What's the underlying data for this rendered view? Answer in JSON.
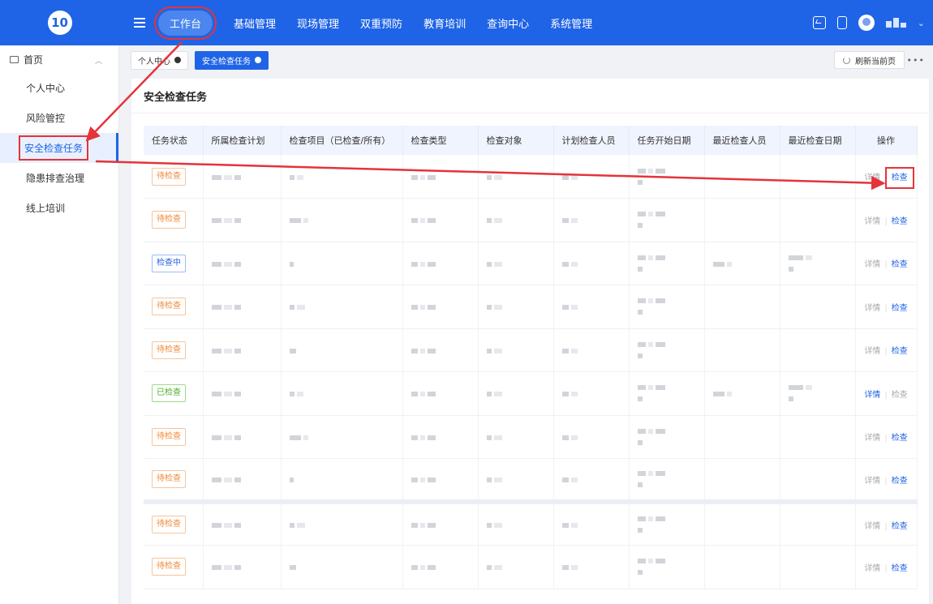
{
  "topbar": {
    "nav": [
      "工作台",
      "基础管理",
      "现场管理",
      "双重预防",
      "教育培训",
      "查询中心",
      "系统管理"
    ]
  },
  "sidebar": {
    "home": "首页",
    "items": [
      "个人中心",
      "风险管控",
      "安全检查任务",
      "隐患排查治理",
      "线上培训"
    ]
  },
  "tabs": {
    "items": [
      "个人中心",
      "安全检查任务"
    ],
    "refresh": "刷新当前页",
    "more": "•••"
  },
  "page": {
    "title": "安全检查任务"
  },
  "table": {
    "headers": [
      "任务状态",
      "所属检查计划",
      "检查项目（已检查/所有）",
      "检查类型",
      "检查对象",
      "计划检查人员",
      "任务开始日期",
      "最近检查人员",
      "最近检查日期",
      "操作"
    ],
    "rows": [
      {
        "status": "待检查"
      },
      {
        "status": "待检查"
      },
      {
        "status": "检查中"
      },
      {
        "status": "待检查"
      },
      {
        "status": "待检查"
      },
      {
        "status": "已检查"
      },
      {
        "status": "待检查"
      },
      {
        "status": "待检查"
      },
      {
        "status": "待检查"
      },
      {
        "status": "待检查"
      }
    ],
    "op_detail": "详情",
    "op_check": "检查"
  },
  "colors": {
    "brand": "#1f64e6",
    "annotation": "#e5333a",
    "pending": "#f08a3a",
    "checking": "#1f64e6",
    "done": "#4cae2a"
  },
  "icons": [
    "logo-icon",
    "menu-icon",
    "monitor-chart-icon",
    "mobile-icon",
    "avatar-icon",
    "chevron-down-icon",
    "refresh-icon",
    "close-icon"
  ]
}
